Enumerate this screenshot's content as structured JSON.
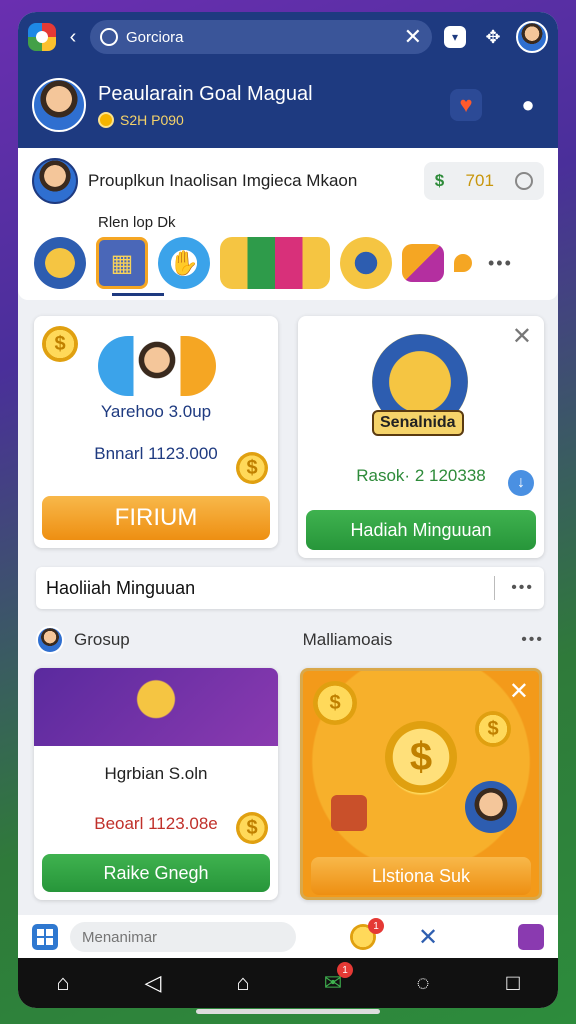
{
  "browser": {
    "search_text": "Gorciora"
  },
  "profile": {
    "name": "Peaularain Goal Magual",
    "sub_text": "S2H P090"
  },
  "group": {
    "title": "Prouplkun Inaolisan Imgieca Mkaon",
    "balance": "701",
    "categories_label": "Rlen lop Dk"
  },
  "promo_left": {
    "title": "Yarehoo 3.0up",
    "amount": "Bnnarl 1123.000",
    "button": "FIRIUM"
  },
  "promo_right": {
    "banner": "Senalnida",
    "amount": "Rasok· 2 120338",
    "button": "Hadiah Minguuan"
  },
  "section": {
    "title": "Haoliiah Minguuan"
  },
  "subheads": {
    "left": "Grosup",
    "right": "Malliamoais"
  },
  "card_left": {
    "title": "Hgrbian S.oln",
    "amount": "Beoarl 1123.08e",
    "button": "Raike Gnegh"
  },
  "card_right": {
    "button": "Llstiona Suk"
  },
  "input": {
    "placeholder": "Menanimar",
    "coin_badge": "1"
  },
  "navbar": {
    "inbox_badge": "1"
  },
  "colors": {
    "header": "#1e3a80",
    "orange_button": "#ee8f12",
    "green_button": "#27963a",
    "amount_blue": "#1e3a80",
    "amount_green": "#2e8b3a",
    "amount_red": "#c0302a"
  }
}
